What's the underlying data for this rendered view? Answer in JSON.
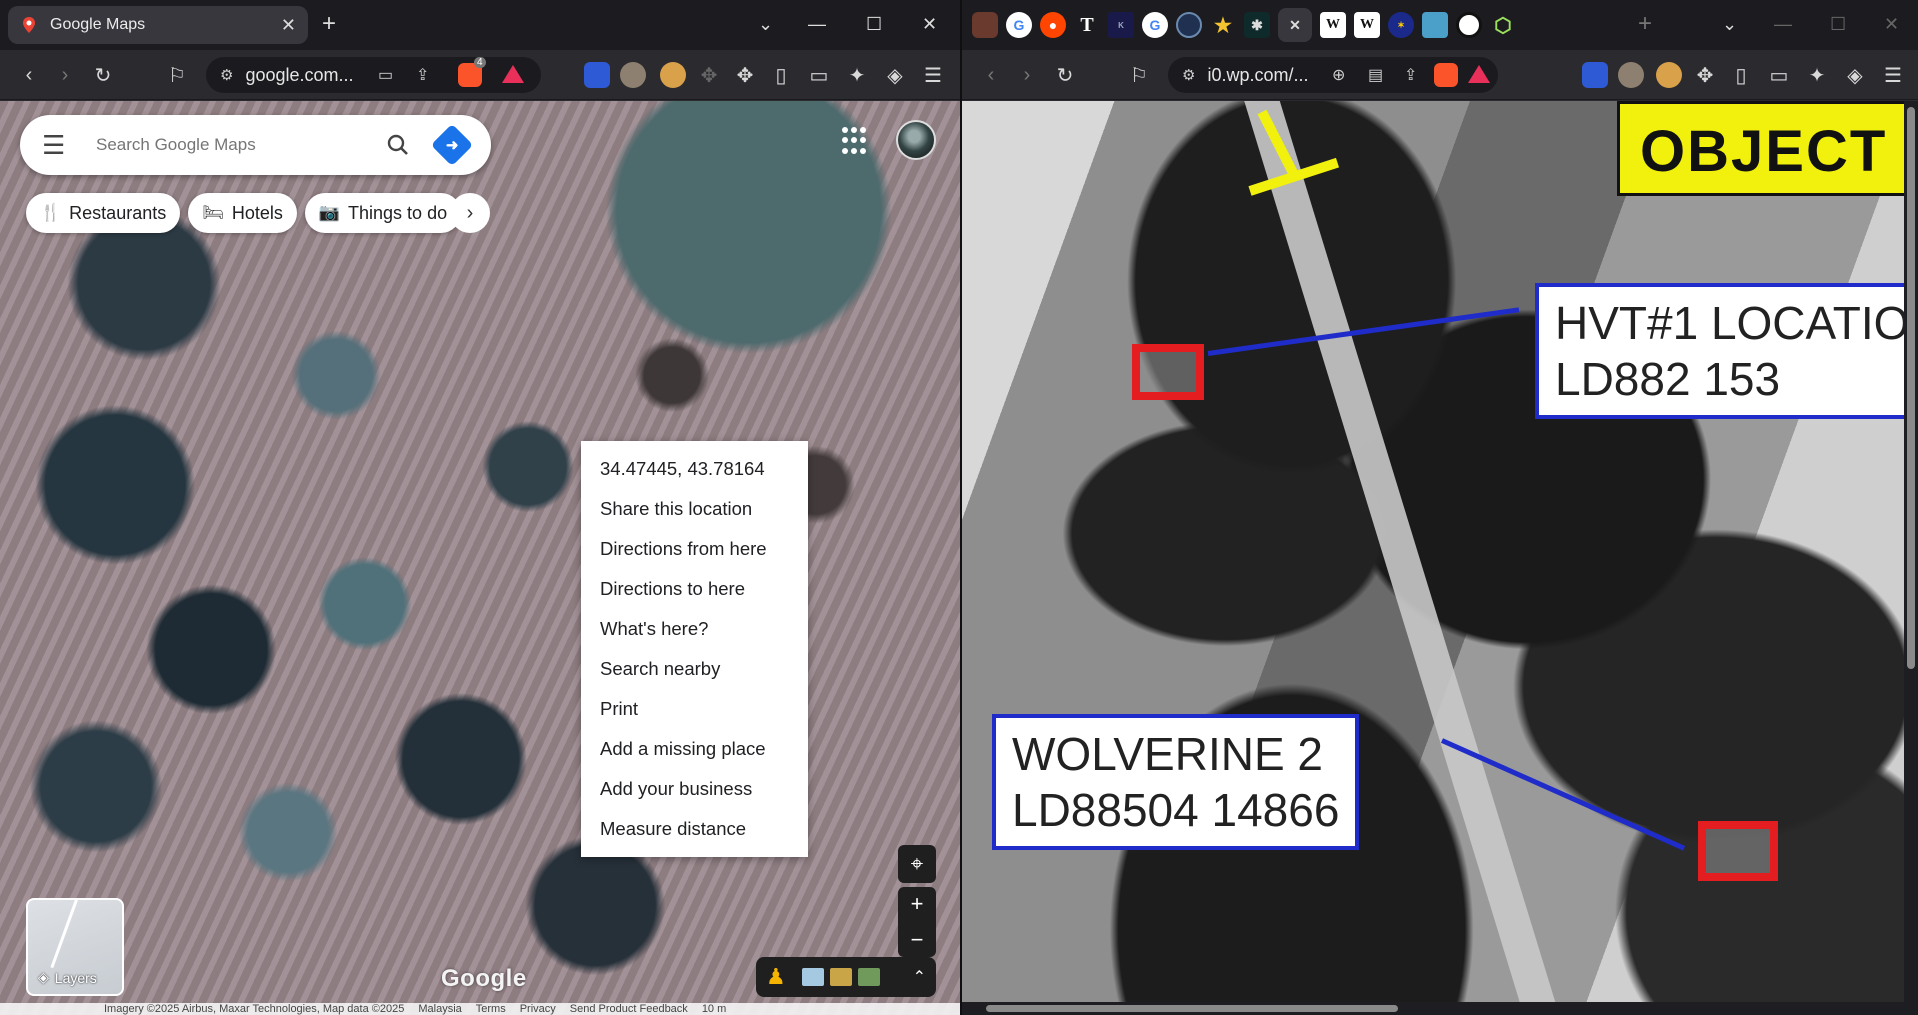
{
  "left_window": {
    "tab": {
      "title": "Google Maps"
    },
    "toolbar": {
      "url": "google.com...",
      "brave_badge": "4"
    },
    "maps": {
      "search_placeholder": "Search Google Maps",
      "chips": [
        {
          "label": "Restaurants",
          "icon": "fork-knife-icon"
        },
        {
          "label": "Hotels",
          "icon": "bed-icon"
        },
        {
          "label": "Things to do",
          "icon": "camera-icon"
        }
      ],
      "context_menu": [
        "34.47445, 43.78164",
        "Share this location",
        "Directions from here",
        "Directions to here",
        "What's here?",
        "Search nearby",
        "Print",
        "Add a missing place",
        "Add your business",
        "Measure distance"
      ],
      "layers_label": "Layers",
      "google_logo": "Google",
      "footer": [
        "Imagery ©2025 Airbus, Maxar Technologies, Map data ©2025",
        "Malaysia",
        "Terms",
        "Privacy",
        "Send Product Feedback",
        "10 m"
      ]
    }
  },
  "right_window": {
    "toolbar": {
      "url": "i0.wp.com/..."
    },
    "image": {
      "objective_label": "OBJECT",
      "hvt_label_line1": "HVT#1 LOCATIO",
      "hvt_label_line2": "LD882 153",
      "wolverine_line1": "WOLVERINE 2",
      "wolverine_line2": "LD88504 14866"
    }
  },
  "colors": {
    "maps_blue": "#1a73e8",
    "annotation_blue": "#1f2cc9",
    "annotation_red": "#e41e20",
    "annotation_yellow": "#f1f10d"
  }
}
